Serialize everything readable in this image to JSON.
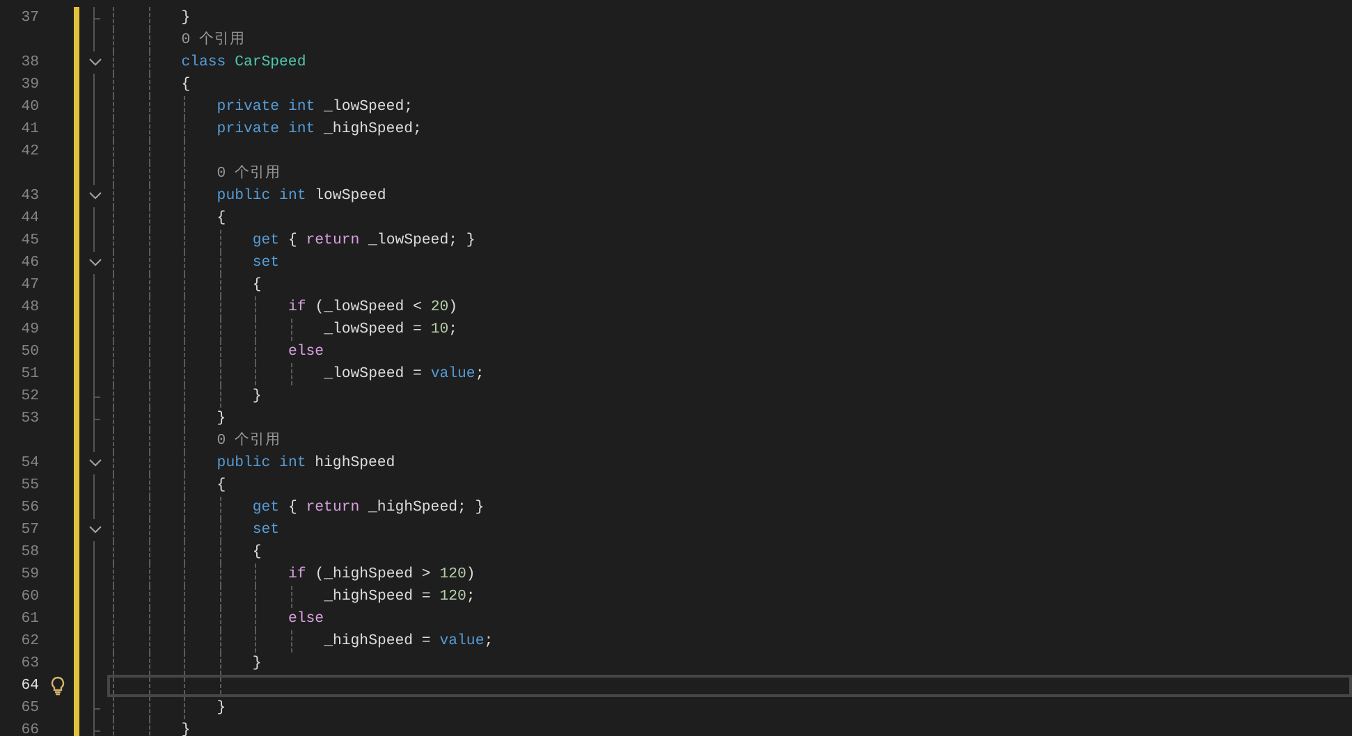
{
  "editor": {
    "lines": [
      {
        "number": "37",
        "block_end": true,
        "tokens": [
          {
            "kind": "plain",
            "text": "}"
          }
        ]
      },
      {
        "kind": "codelens",
        "text": "0 个引用"
      },
      {
        "number": "38",
        "collapsible": true,
        "tokens": [
          {
            "kind": "keyword",
            "text": "class"
          },
          {
            "kind": "type",
            "text": " CarSpeed"
          }
        ]
      },
      {
        "number": "39",
        "tokens": [
          {
            "kind": "plain",
            "text": "{"
          }
        ],
        "children": [
          {
            "number": "40",
            "tokens": [
              {
                "kind": "keyword",
                "text": "private int"
              },
              {
                "kind": "plain",
                "text": " _lowSpeed;"
              }
            ]
          },
          {
            "number": "41",
            "tokens": [
              {
                "kind": "keyword",
                "text": "private int"
              },
              {
                "kind": "plain",
                "text": " _highSpeed;"
              }
            ]
          },
          {
            "number": "42"
          },
          {
            "kind": "codelens",
            "text": "0 个引用"
          },
          {
            "number": "43",
            "collapsible": true,
            "tokens": [
              {
                "kind": "keyword",
                "text": "public int"
              },
              {
                "kind": "plain",
                "text": " lowSpeed"
              }
            ]
          },
          {
            "number": "44",
            "tokens": [
              {
                "kind": "plain",
                "text": "{"
              }
            ],
            "children": [
              {
                "number": "45",
                "tokens": [
                  {
                    "kind": "keyword",
                    "text": "get"
                  },
                  {
                    "kind": "plain",
                    "text": " { "
                  },
                  {
                    "kind": "control",
                    "text": "return"
                  },
                  {
                    "kind": "plain",
                    "text": " _lowSpeed; }"
                  }
                ]
              },
              {
                "number": "46",
                "collapsible": true,
                "tokens": [
                  {
                    "kind": "keyword",
                    "text": "set"
                  }
                ]
              },
              {
                "number": "47",
                "tokens": [
                  {
                    "kind": "plain",
                    "text": "{"
                  }
                ],
                "children": [
                  {
                    "number": "48",
                    "tokens": [
                      {
                        "kind": "control",
                        "text": "if"
                      },
                      {
                        "kind": "plain",
                        "text": " (_lowSpeed < "
                      },
                      {
                        "kind": "number",
                        "text": "20"
                      },
                      {
                        "kind": "plain",
                        "text": ")"
                      }
                    ],
                    "children": [
                      {
                        "number": "49",
                        "tokens": [
                          {
                            "kind": "plain",
                            "text": "_lowSpeed = "
                          },
                          {
                            "kind": "number",
                            "text": "10"
                          },
                          {
                            "kind": "plain",
                            "text": ";"
                          }
                        ]
                      }
                    ]
                  },
                  {
                    "number": "50",
                    "tokens": [
                      {
                        "kind": "control",
                        "text": "else"
                      }
                    ],
                    "children": [
                      {
                        "number": "51",
                        "tokens": [
                          {
                            "kind": "plain",
                            "text": "_lowSpeed = "
                          },
                          {
                            "kind": "keyword",
                            "text": "value"
                          },
                          {
                            "kind": "plain",
                            "text": ";"
                          }
                        ]
                      }
                    ]
                  }
                ]
              },
              {
                "number": "52",
                "block_end": true,
                "tokens": [
                  {
                    "kind": "plain",
                    "text": "}"
                  }
                ]
              }
            ]
          },
          {
            "number": "53",
            "block_end": true,
            "tokens": [
              {
                "kind": "plain",
                "text": "}"
              }
            ]
          },
          {
            "kind": "codelens",
            "text": "0 个引用"
          },
          {
            "number": "54",
            "collapsible": true,
            "tokens": [
              {
                "kind": "keyword",
                "text": "public int"
              },
              {
                "kind": "plain",
                "text": " highSpeed"
              }
            ]
          },
          {
            "number": "55",
            "tokens": [
              {
                "kind": "plain",
                "text": "{"
              }
            ],
            "children": [
              {
                "number": "56",
                "tokens": [
                  {
                    "kind": "keyword",
                    "text": "get"
                  },
                  {
                    "kind": "plain",
                    "text": " { "
                  },
                  {
                    "kind": "control",
                    "text": "return"
                  },
                  {
                    "kind": "plain",
                    "text": " _highSpeed; }"
                  }
                ]
              },
              {
                "number": "57",
                "collapsible": true,
                "tokens": [
                  {
                    "kind": "keyword",
                    "text": "set"
                  }
                ]
              },
              {
                "number": "58",
                "tokens": [
                  {
                    "kind": "plain",
                    "text": "{"
                  }
                ],
                "children": [
                  {
                    "number": "59",
                    "tokens": [
                      {
                        "kind": "control",
                        "text": "if"
                      },
                      {
                        "kind": "plain",
                        "text": " (_highSpeed > "
                      },
                      {
                        "kind": "number",
                        "text": "120"
                      },
                      {
                        "kind": "plain",
                        "text": ")"
                      }
                    ],
                    "children": [
                      {
                        "number": "60",
                        "tokens": [
                          {
                            "kind": "plain",
                            "text": "_highSpeed = "
                          },
                          {
                            "kind": "number",
                            "text": "120"
                          },
                          {
                            "kind": "plain",
                            "text": ";"
                          }
                        ]
                      }
                    ]
                  },
                  {
                    "number": "61",
                    "tokens": [
                      {
                        "kind": "control",
                        "text": "else"
                      }
                    ],
                    "children": [
                      {
                        "number": "62",
                        "tokens": [
                          {
                            "kind": "plain",
                            "text": "_highSpeed = "
                          },
                          {
                            "kind": "keyword",
                            "text": "value"
                          },
                          {
                            "kind": "plain",
                            "text": ";"
                          }
                        ]
                      }
                    ]
                  }
                ]
              },
              {
                "number": "63",
                "tokens": [
                  {
                    "kind": "plain",
                    "text": "}"
                  }
                ]
              },
              {
                "number": "64",
                "current": true,
                "lightbulb": true
              }
            ]
          },
          {
            "number": "65",
            "block_end": true,
            "tokens": [
              {
                "kind": "plain",
                "text": "}"
              }
            ]
          }
        ]
      },
      {
        "number": "66",
        "block_end": true,
        "tokens": [
          {
            "kind": "plain",
            "text": "}"
          }
        ]
      }
    ]
  }
}
